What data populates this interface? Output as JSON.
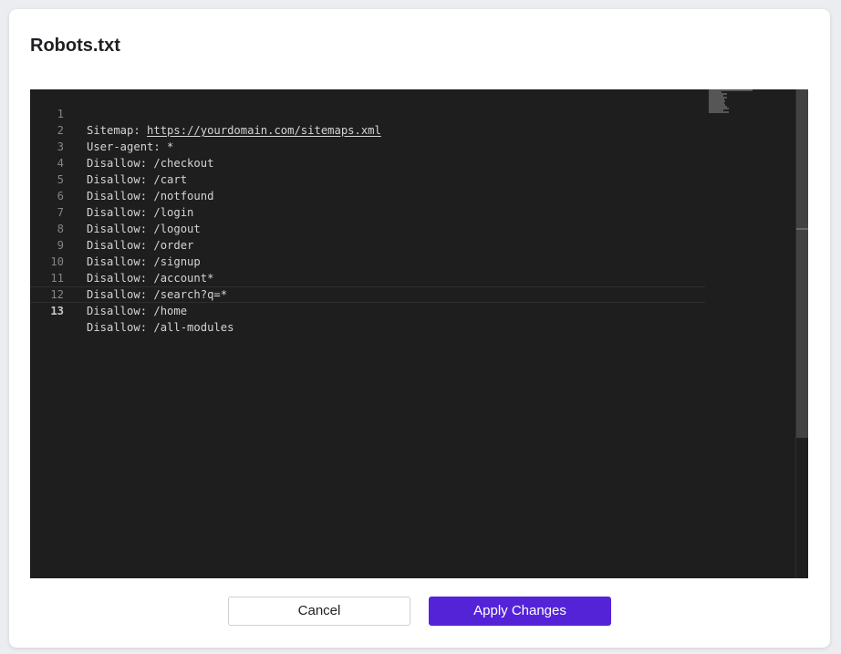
{
  "dialog": {
    "title": "Robots.txt"
  },
  "editor": {
    "current_line": 13,
    "lines": [
      {
        "number": "1",
        "text": "Sitemap: ",
        "link": "https://yourdomain.com/sitemaps.xml"
      },
      {
        "number": "2",
        "text": "User-agent: *"
      },
      {
        "number": "3",
        "text": "Disallow: /checkout"
      },
      {
        "number": "4",
        "text": "Disallow: /cart"
      },
      {
        "number": "5",
        "text": "Disallow: /notfound"
      },
      {
        "number": "6",
        "text": "Disallow: /login"
      },
      {
        "number": "7",
        "text": "Disallow: /logout"
      },
      {
        "number": "8",
        "text": "Disallow: /order"
      },
      {
        "number": "9",
        "text": "Disallow: /signup"
      },
      {
        "number": "10",
        "text": "Disallow: /account*"
      },
      {
        "number": "11",
        "text": "Disallow: /search?q=*"
      },
      {
        "number": "12",
        "text": "Disallow: /home"
      },
      {
        "number": "13",
        "text": "Disallow: /all-modules"
      }
    ]
  },
  "buttons": {
    "cancel_label": "Cancel",
    "apply_label": "Apply Changes"
  },
  "colors": {
    "accent": "#5423d8",
    "editor_background": "#1e1e1e",
    "editor_text": "#d4d4d4",
    "line_number": "#858585"
  }
}
